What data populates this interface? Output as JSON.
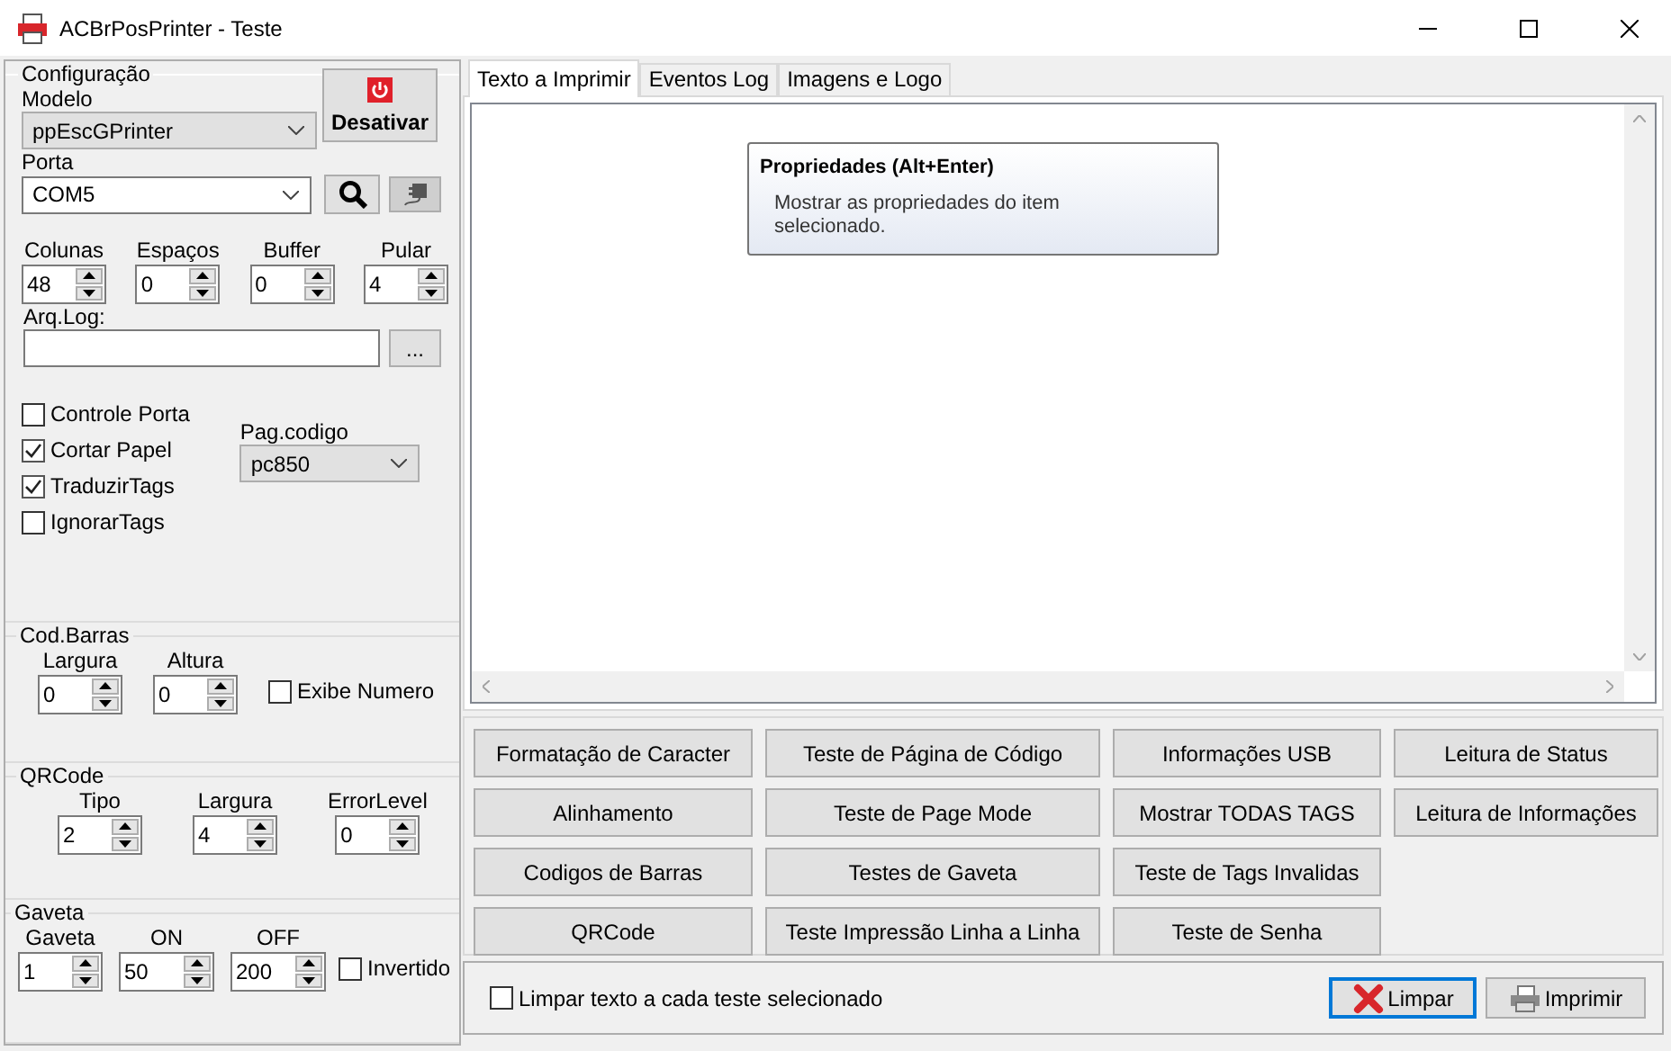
{
  "window": {
    "title": "ACBrPosPrinter - Teste"
  },
  "configuracao": {
    "title": "Configuração",
    "modelo": {
      "label": "Modelo",
      "value": "ppEscGPrinter"
    },
    "desativar": "Desativar",
    "porta": {
      "label": "Porta",
      "value": "COM5"
    },
    "spins": [
      {
        "label": "Colunas",
        "value": "48"
      },
      {
        "label": "Espaços",
        "value": "0"
      },
      {
        "label": "Buffer",
        "value": "0"
      },
      {
        "label": "Pular",
        "value": "4"
      }
    ],
    "arq_log": {
      "label": "Arq.Log:",
      "browse": "..."
    },
    "checks": [
      {
        "label": "Controle Porta",
        "checked": false
      },
      {
        "label": "Cortar Papel",
        "checked": true
      },
      {
        "label": "TraduzirTags",
        "checked": true
      },
      {
        "label": "IgnorarTags",
        "checked": false
      }
    ],
    "pag_codigo": {
      "label": "Pag.codigo",
      "value": "pc850"
    }
  },
  "cod_barras": {
    "title": "Cod.Barras",
    "spins": [
      {
        "label": "Largura",
        "value": "0"
      },
      {
        "label": "Altura",
        "value": "0"
      }
    ],
    "check": {
      "label": "Exibe Numero",
      "checked": false
    }
  },
  "qrcode": {
    "title": "QRCode",
    "spins": [
      {
        "label": "Tipo",
        "value": "2"
      },
      {
        "label": "Largura",
        "value": "4"
      },
      {
        "label": "ErrorLevel",
        "value": "0"
      }
    ]
  },
  "gaveta": {
    "title": "Gaveta",
    "spins": [
      {
        "label": "Gaveta",
        "value": "1"
      },
      {
        "label": "ON",
        "value": "50"
      },
      {
        "label": "OFF",
        "value": "200"
      }
    ],
    "check": {
      "label": "Invertido",
      "checked": false
    }
  },
  "tabs": [
    {
      "label": "Texto a Imprimir",
      "selected": true
    },
    {
      "label": "Eventos Log",
      "selected": false
    },
    {
      "label": "Imagens e Logo",
      "selected": false
    }
  ],
  "tooltip": {
    "title": "Propriedades (Alt+Enter)",
    "text": "Mostrar as propriedades do item selecionado."
  },
  "test_buttons": [
    [
      "Formatação de Caracter",
      "Teste de Página de Código",
      "Informações USB",
      "Leitura de Status"
    ],
    [
      "Alinhamento",
      "Teste de Page Mode",
      "Mostrar TODAS TAGS",
      "Leitura de Informações"
    ],
    [
      "Codigos de Barras",
      "Testes de Gaveta",
      "Teste de Tags Invalidas"
    ],
    [
      "QRCode",
      "Teste Impressão Linha a Linha",
      "Teste de Senha"
    ]
  ],
  "footer": {
    "clear_check": {
      "label": "Limpar texto a cada teste selecionado",
      "checked": false
    },
    "limpar": "Limpar",
    "imprimir": "Imprimir"
  }
}
